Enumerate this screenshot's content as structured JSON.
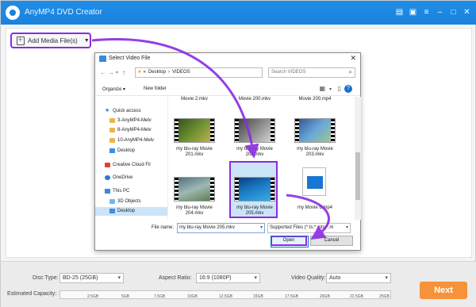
{
  "app": {
    "title": "AnyMP4 DVD Creator",
    "titlebar_icons": [
      "document-icon",
      "cart-icon",
      "menu-icon",
      "minimize-icon",
      "maximize-icon",
      "close-icon"
    ],
    "add_media_label": "Add Media File(s)",
    "accent_color": "#8a2be2",
    "titlebar_color": "#1a82dd"
  },
  "settings": {
    "disc_type_label": "Disc Type:",
    "disc_type_value": "BD-25 (25GB)",
    "aspect_ratio_label": "Aspect Ratio:",
    "aspect_ratio_value": "16:9 (1080P)",
    "video_quality_label": "Video Quality:",
    "video_quality_value": "Auto",
    "capacity_label": "Estimated Capacity:",
    "capacity_ticks": [
      "2.5GB",
      "5GB",
      "7.5GB",
      "10GB",
      "12.5GB",
      "15GB",
      "17.5GB",
      "20GB",
      "22.5GB",
      "25GB"
    ],
    "next_label": "Next",
    "next_color": "#f6923a"
  },
  "dialog": {
    "title": "Select Video File",
    "path": [
      "Desktop",
      "VIDEOS"
    ],
    "search_placeholder": "Search VIDEOS",
    "organize_label": "Organize ▾",
    "new_folder_label": "New folder",
    "nav": {
      "quick_access": "Quick access",
      "items": [
        "3-AnyMP4-Melv",
        "8-AnyMP4-Melv",
        "10-AnyMP4-Melv",
        "Desktop"
      ],
      "creative_cloud": "Creative Cloud Fil",
      "onedrive": "OneDrive",
      "this_pc": "This PC",
      "objects_3d": "3D Objects",
      "desktop": "Desktop"
    },
    "files_top": [
      "Movie 2.mkv",
      "Movie 200.mkv",
      "Movie 200.mp4"
    ],
    "files": [
      {
        "name": "my blu-ray Movie 201.mkv"
      },
      {
        "name": "my blu-ray Movie 202.mkv"
      },
      {
        "name": "my blu-ray Movie 203.mkv"
      },
      {
        "name": "my blu-ray Movie 204.mkv"
      },
      {
        "name": "my blu-ray Movie 205.mkv"
      },
      {
        "name": "my Movie 6.mp4"
      }
    ],
    "file_name_label": "File name:",
    "file_name_value": "my blu-ray Movie 205.mkv",
    "file_type_value": "Supported Files (*.ts;*.mts;*.m",
    "open_label": "Open",
    "cancel_label": "Cancel"
  }
}
